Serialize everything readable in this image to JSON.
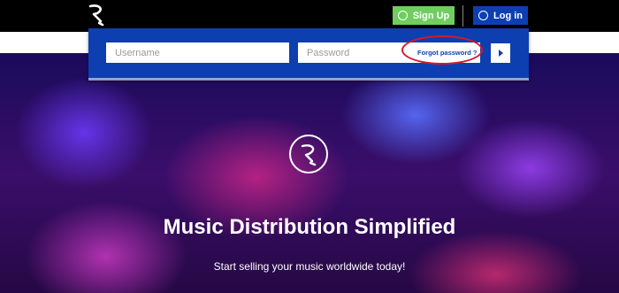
{
  "header": {
    "logo_icon": "r-logo-icon",
    "signup_label": "Sign Up",
    "signup_icon": "user-circle-icon",
    "login_label": "Log in",
    "login_icon": "compass-icon",
    "signup_color": "#6fce5f",
    "login_color": "#0d3fb0"
  },
  "login_panel": {
    "username_placeholder": "Username",
    "password_placeholder": "Password",
    "forgot_label": "Forgot password ?",
    "submit_icon": "play-arrow-icon",
    "panel_color": "#0d3fb0",
    "highlight_color": "#d6192a"
  },
  "hero": {
    "logo_icon": "r-logo-circle-icon",
    "title": "Music Distribution Simplified",
    "subtitle": "Start selling your music worldwide today!"
  }
}
